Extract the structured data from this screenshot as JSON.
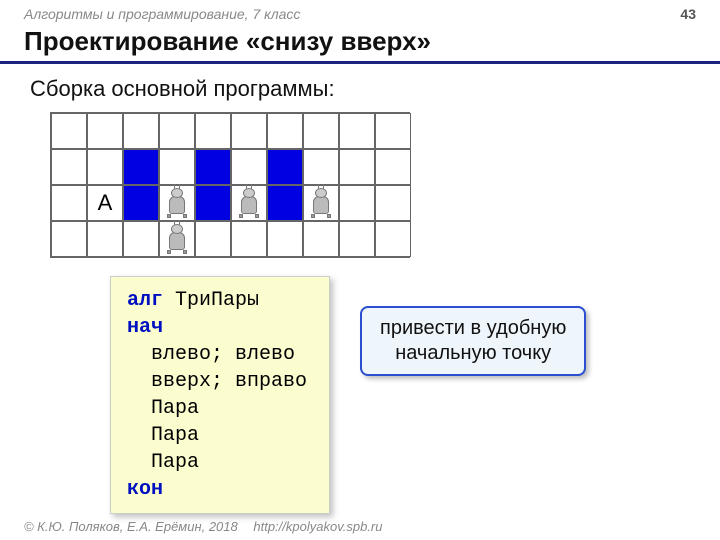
{
  "header": {
    "course": "Алгоритмы и программирование, 7 класс",
    "page": "43"
  },
  "title": "Проектирование «снизу вверх»",
  "subtitle": "Сборка основной программы:",
  "grid": {
    "label_A": "А",
    "rows": 4,
    "cols": 10,
    "blue_cells": [
      [
        1,
        2
      ],
      [
        1,
        4
      ],
      [
        1,
        6
      ],
      [
        2,
        2
      ],
      [
        2,
        4
      ],
      [
        2,
        6
      ]
    ],
    "label_cell": [
      2,
      1
    ],
    "robot_cells": [
      [
        2,
        3
      ],
      [
        2,
        5
      ],
      [
        2,
        7
      ],
      [
        3,
        3
      ]
    ]
  },
  "code": {
    "kw_alg": "алг",
    "name": "ТриПары",
    "kw_begin": "нач",
    "line1": "  влево; влево",
    "line2": "  вверх; вправо",
    "line3": "  Пара",
    "line4": "  Пара",
    "line5": "  Пара",
    "kw_end": "кон"
  },
  "callout": {
    "line1": "привести в удобную",
    "line2": "начальную точку"
  },
  "footer": {
    "copyright": "© К.Ю. Поляков, Е.А. Ерёмин, 2018",
    "url": "http://kpolyakov.spb.ru"
  }
}
